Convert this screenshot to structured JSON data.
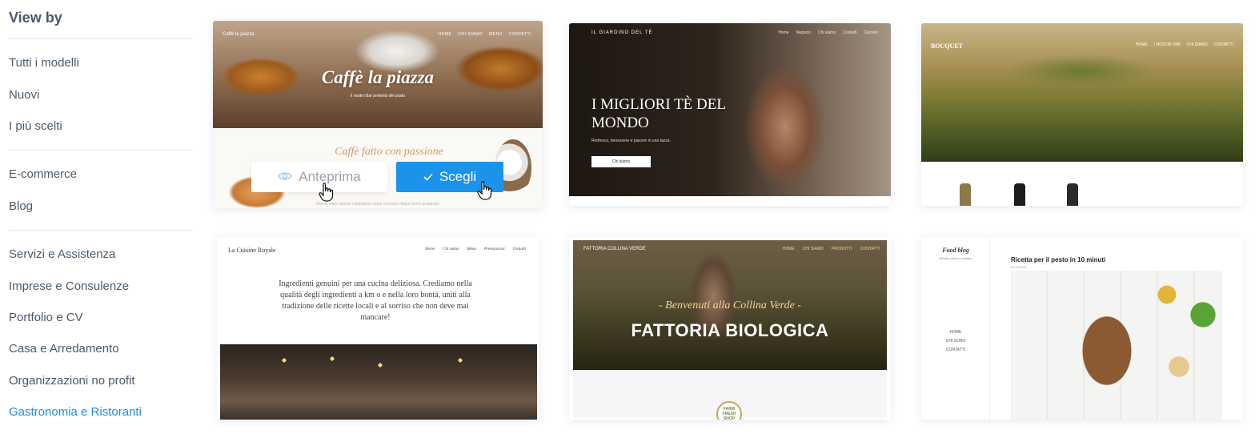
{
  "sidebar": {
    "title": "View by",
    "group1": [
      "Tutti i modelli",
      "Nuovi",
      "I più scelti"
    ],
    "group2": [
      "E-commerce",
      "Blog"
    ],
    "group3": [
      "Servizi e Assistenza",
      "Imprese e Consulenze",
      "Portfolio e CV",
      "Casa e Arredamento",
      "Organizzazioni no profit",
      "Gastronomia e Ristoranti"
    ],
    "active": "Gastronomia e Ristoranti"
  },
  "accent_color": "#1b93ea",
  "templates": [
    {
      "brand": "Caffè la piazza",
      "nav": [
        "HOME",
        "CHI SIAMO",
        "MENU",
        "CONTATTI"
      ],
      "headline": "Caffè la piazza",
      "subline": "Il nostro Bar preferito del posto",
      "tagline": "Caffè fatto con passione",
      "footer_text": "Donec vitae ratione voluptatem sequi nesciunt neque porro quisquam",
      "preview_label": "Anteprima",
      "choose_label": "Scegli"
    },
    {
      "brand": "IL GIARDINO DEL TÈ",
      "nav": [
        "Home",
        "Negozio",
        "Chi siamo",
        "Contatti",
        "Carrello"
      ],
      "headline": "I MIGLIORI TÈ DEL MONDO",
      "subline": "Rinfresco, benessere e piacere in una tazza",
      "cta": "Chi siamo"
    },
    {
      "brand": "BOUQUET",
      "nav": [
        "HOME",
        "I NOSTRI VINI",
        "CHI SIAMO",
        "CONTATTI"
      ]
    },
    {
      "brand": "La Cuisine Royale",
      "nav": [
        "Home",
        "Chi siamo",
        "Menu",
        "Prenotazioni",
        "Contatti"
      ],
      "text": "Ingredienti genuini per una cucina deliziosa. Crediamo nella qualità degli ingredienti a km o e nella loro bontà, uniti alla tradizione delle ricette locali e al sorriso che non deve mai mancare!"
    },
    {
      "brand": "FATTORIA COLLINA VERDE",
      "nav": [
        "HOME",
        "CHI SIAMO",
        "PRODOTTI",
        "CONTATTI"
      ],
      "script": "- Benvenuti alla Collina Verde -",
      "headline": "FATTORIA BIOLOGICA",
      "badge": "FARM FRESH SHOP"
    },
    {
      "brand": "Food blog",
      "tagline": "Ricette veloci e salutari",
      "menu": [
        "HOME",
        "CHI SONO",
        "CONTATTI"
      ],
      "post_title": "Ricetta per il pesto in 10 minuti",
      "post_date": "21.09.2021"
    }
  ]
}
